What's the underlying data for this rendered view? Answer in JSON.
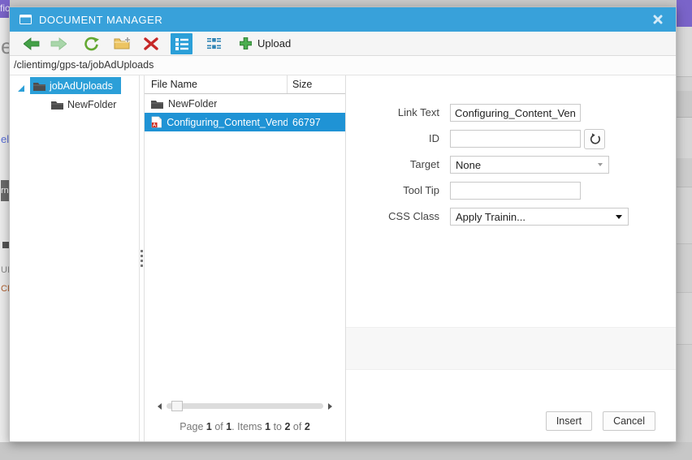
{
  "backdrop": {
    "fragments": {
      "top_left": "fic",
      "heading": "e",
      "link": "el",
      "badge": "rn",
      "line1": "UI",
      "line2": "CRI"
    }
  },
  "dialog": {
    "title": "DOCUMENT MANAGER"
  },
  "toolbar": {
    "upload_label": "Upload"
  },
  "address": {
    "path": "/clientimg/gps-ta/jobAdUploads"
  },
  "tree": {
    "items": [
      {
        "label": "jobAdUploads",
        "selected": true,
        "expanded": true
      },
      {
        "label": "NewFolder",
        "selected": false
      }
    ]
  },
  "files": {
    "columns": {
      "name": "File Name",
      "size": "Size"
    },
    "rows": [
      {
        "name": "NewFolder",
        "size": "",
        "icon": "folder-icon",
        "selected": false
      },
      {
        "name": "Configuring_Content_Vendo",
        "size": "66797",
        "icon": "pdf-file-icon",
        "selected": true
      }
    ],
    "pager": {
      "segments": [
        "Page ",
        "1",
        " of ",
        "1",
        ". Items ",
        "1",
        " to ",
        "2",
        " of ",
        "2"
      ]
    }
  },
  "form": {
    "link_text": {
      "label": "Link Text",
      "value": "Configuring_Content_Vendor"
    },
    "id": {
      "label": "ID",
      "value": ""
    },
    "target": {
      "label": "Target",
      "value": "None"
    },
    "tooltip": {
      "label": "Tool Tip",
      "value": ""
    },
    "css_class": {
      "label": "CSS Class",
      "value": "Apply Trainin..."
    }
  },
  "footer": {
    "insert_label": "Insert",
    "cancel_label": "Cancel"
  },
  "colors": {
    "titlebar": "#38a1da",
    "selection": "#1f93d5",
    "toolbar_selected": "#2b9fd8",
    "accent_green": "#3fa53f"
  }
}
